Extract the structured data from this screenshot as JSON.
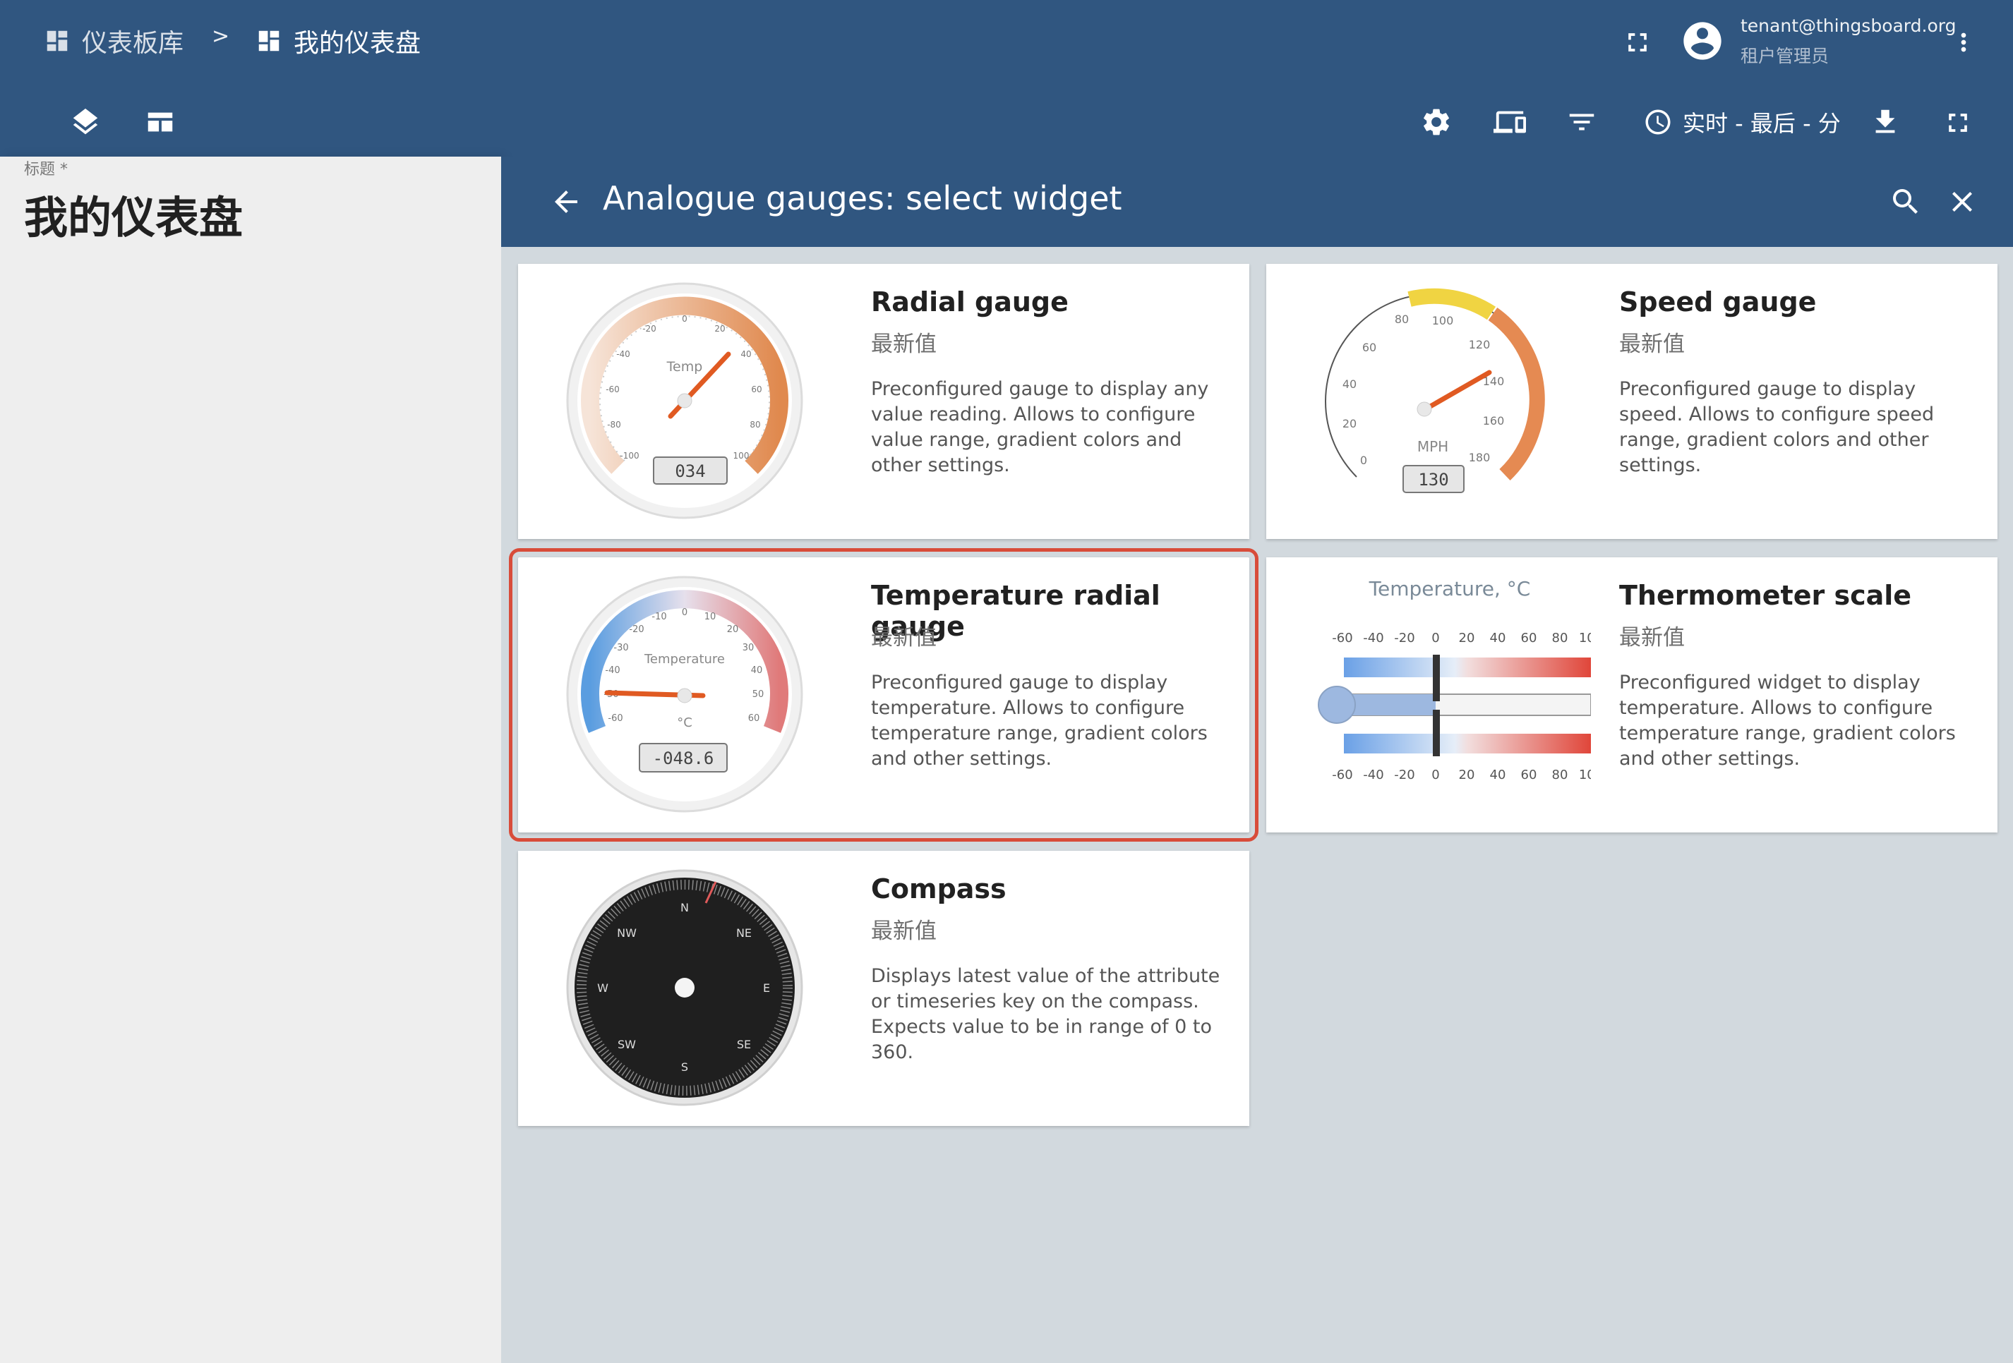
{
  "breadcrumb": {
    "library": "仪表板库",
    "separator": ">",
    "current": "我的仪表盘"
  },
  "user": {
    "email": "tenant@thingsboard.org",
    "role": "租户管理员"
  },
  "toolbar": {
    "timewindow": "实时 - 最后 - 分"
  },
  "title_field": {
    "label": "标题 *",
    "value": "我的仪表盘"
  },
  "drawer": {
    "title": "Analogue gauges: select widget"
  },
  "widgets": [
    {
      "name": "Radial gauge",
      "type": "最新值",
      "description": "Preconfigured gauge to display any value reading. Allows to configure value range, gradient colors and other settings.",
      "preview": {
        "label": "Temp",
        "readout": "034",
        "ticks": [
          "0",
          "20",
          "40",
          "60",
          "80",
          "100",
          "-20",
          "-40",
          "-60",
          "-80",
          "-100"
        ]
      }
    },
    {
      "name": "Speed gauge",
      "type": "最新值",
      "description": "Preconfigured gauge to display speed. Allows to configure speed range, gradient colors and other settings.",
      "preview": {
        "label": "MPH",
        "readout": "130",
        "ticks": [
          "0",
          "20",
          "40",
          "60",
          "80",
          "100",
          "120",
          "140",
          "160",
          "180"
        ]
      }
    },
    {
      "name": "Temperature radial gauge",
      "type": "最新值",
      "description": "Preconfigured gauge to display temperature. Allows to configure temperature range, gradient colors and other settings.",
      "selected": true,
      "preview": {
        "label": "Temperature",
        "unit": "°C",
        "readout": "-048.6",
        "ticks": [
          "0",
          "10",
          "20",
          "30",
          "40",
          "50",
          "60",
          "-10",
          "-20",
          "-30",
          "-40",
          "-50",
          "-60"
        ]
      }
    },
    {
      "name": "Thermometer scale",
      "type": "最新值",
      "description": "Preconfigured widget to display temperature. Allows to configure temperature range, gradient colors and other settings.",
      "preview": {
        "label": "Temperature, °C",
        "ticks": [
          "-60",
          "-40",
          "-20",
          "0",
          "20",
          "40",
          "60",
          "80",
          "100"
        ]
      }
    },
    {
      "name": "Compass",
      "type": "最新值",
      "description": "Displays latest value of the attribute or timeseries key on the compass. Expects value to be in range of 0 to 360.",
      "preview": {
        "dirs": [
          "N",
          "NE",
          "E",
          "SE",
          "S",
          "SW",
          "W",
          "NW"
        ]
      }
    }
  ]
}
